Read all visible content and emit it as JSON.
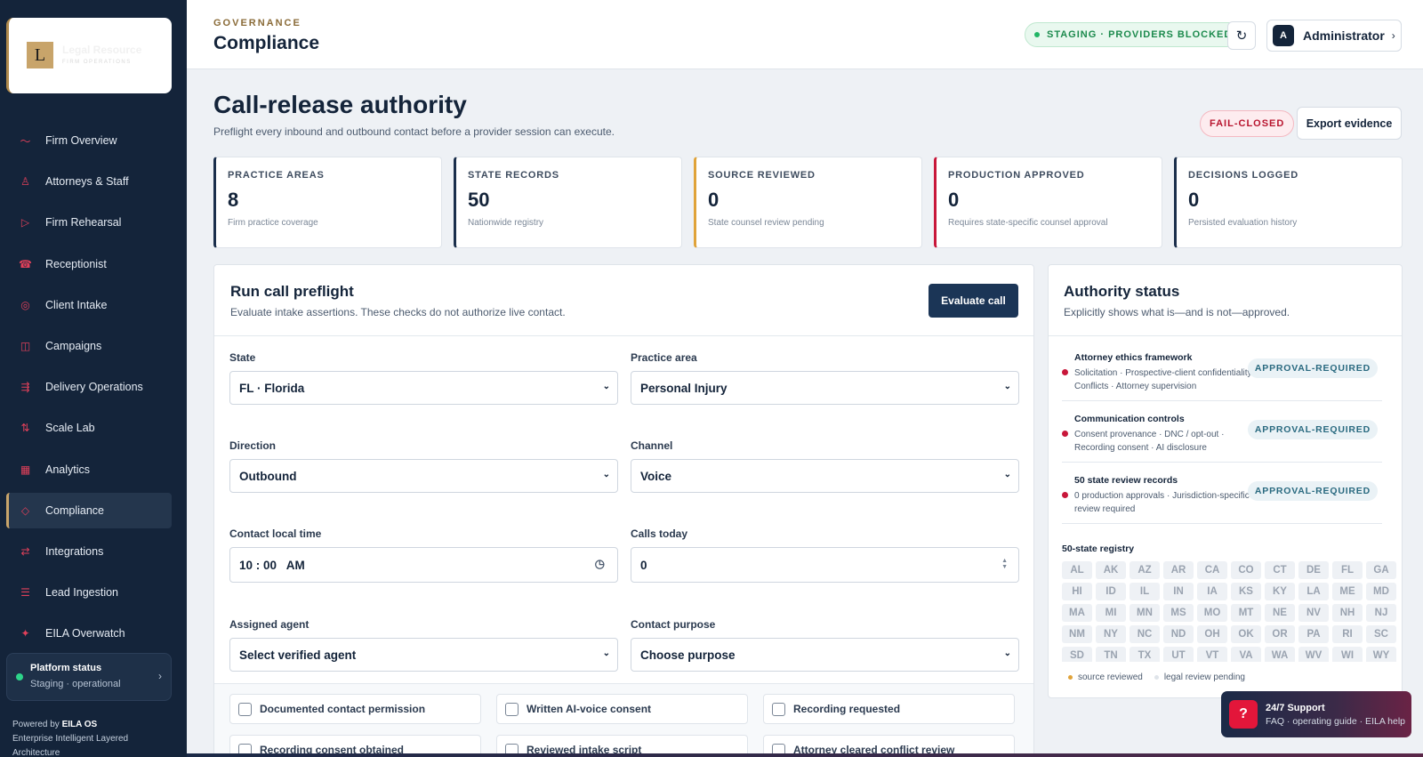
{
  "brand": {
    "logo_letter": "L",
    "name": "Legal Resource",
    "tagline": "FIRM OPERATIONS"
  },
  "sidebar": {
    "items": [
      {
        "label": "Firm Overview",
        "icon": "pulse-icon"
      },
      {
        "label": "Attorneys & Staff",
        "icon": "person-icon"
      },
      {
        "label": "Firm Rehearsal",
        "icon": "play-icon"
      },
      {
        "label": "Receptionist",
        "icon": "phone-icon"
      },
      {
        "label": "Client Intake",
        "icon": "target-icon"
      },
      {
        "label": "Campaigns",
        "icon": "columns-icon"
      },
      {
        "label": "Delivery Operations",
        "icon": "list-arrow-icon"
      },
      {
        "label": "Scale Lab",
        "icon": "sort-icon"
      },
      {
        "label": "Analytics",
        "icon": "grid-icon"
      },
      {
        "label": "Compliance",
        "icon": "diamond-icon",
        "active": true
      },
      {
        "label": "Integrations",
        "icon": "swap-icon"
      },
      {
        "label": "Lead Ingestion",
        "icon": "list-icon"
      },
      {
        "label": "EILA Overwatch",
        "icon": "sparkle-icon"
      }
    ],
    "platform_status": {
      "title": "Platform status",
      "subtitle": "Staging · operational"
    },
    "powered_prefix": "Powered by",
    "powered_brand": "EILA OS",
    "powered_line": "Enterprise Intelligent Layered Architecture"
  },
  "header": {
    "eyebrow": "GOVERNANCE",
    "title": "Compliance",
    "env_status": "STAGING · PROVIDERS BLOCKED",
    "refresh_glyph": "↻",
    "user_initial": "A",
    "user_name": "Administrator",
    "user_chevron": "›"
  },
  "page": {
    "title": "Call-release authority",
    "subtitle": "Preflight every inbound and outbound contact before a provider session can execute.",
    "mode_badge": "FAIL-CLOSED",
    "export_label": "Export evidence"
  },
  "stats": [
    {
      "label": "PRACTICE AREAS",
      "value": "8",
      "sub": "Firm practice coverage",
      "accent": "#1b2f4c"
    },
    {
      "label": "STATE RECORDS",
      "value": "50",
      "sub": "Nationwide registry",
      "accent": "#1b2f4c"
    },
    {
      "label": "SOURCE REVIEWED",
      "value": "0",
      "sub": "State counsel review pending",
      "accent": "#e0a33a"
    },
    {
      "label": "PRODUCTION APPROVED",
      "value": "0",
      "sub": "Requires state-specific counsel approval",
      "accent": "#c8173a"
    },
    {
      "label": "DECISIONS LOGGED",
      "value": "0",
      "sub": "Persisted evaluation history",
      "accent": "#1b2f4c"
    }
  ],
  "preflight": {
    "title": "Run call preflight",
    "subtitle": "Evaluate intake assertions. These checks do not authorize live contact.",
    "evaluate_label": "Evaluate call",
    "fields": {
      "state": {
        "label": "State",
        "value": "FL · Florida"
      },
      "practice_area": {
        "label": "Practice area",
        "value": "Personal Injury"
      },
      "direction": {
        "label": "Direction",
        "value": "Outbound"
      },
      "channel": {
        "label": "Channel",
        "value": "Voice"
      },
      "local_time": {
        "label": "Contact local time",
        "value": "10 : 00   AM"
      },
      "calls_today": {
        "label": "Calls today",
        "value": "0"
      },
      "agent": {
        "label": "Assigned agent",
        "value": "Select verified agent"
      },
      "purpose": {
        "label": "Contact purpose",
        "value": "Choose purpose"
      }
    },
    "checks": [
      "Documented contact permission",
      "Written AI-voice consent",
      "Recording requested",
      "Recording consent obtained",
      "Reviewed intake script",
      "Attorney cleared conflict review"
    ]
  },
  "authority": {
    "title": "Authority status",
    "subtitle": "Explicitly shows what is—and is not—approved.",
    "items": [
      {
        "title": "Attorney ethics framework",
        "desc": "Solicitation · Prospective-client confidentiality · Conflicts · Attorney supervision",
        "badge": "APPROVAL-REQUIRED"
      },
      {
        "title": "Communication controls",
        "desc": "Consent provenance · DNC / opt-out · Recording consent · AI disclosure",
        "badge": "APPROVAL-REQUIRED"
      },
      {
        "title": "50 state review records",
        "desc": "0 production approvals · Jurisdiction-specific review required",
        "badge": "APPROVAL-REQUIRED"
      }
    ],
    "registry_title": "50-state registry",
    "states": [
      "AL",
      "AK",
      "AZ",
      "AR",
      "CA",
      "CO",
      "CT",
      "DE",
      "FL",
      "GA",
      "HI",
      "ID",
      "IL",
      "IN",
      "IA",
      "KS",
      "KY",
      "LA",
      "ME",
      "MD",
      "MA",
      "MI",
      "MN",
      "MS",
      "MO",
      "MT",
      "NE",
      "NV",
      "NH",
      "NJ",
      "NM",
      "NY",
      "NC",
      "ND",
      "OH",
      "OK",
      "OR",
      "PA",
      "RI",
      "SC",
      "SD",
      "TN",
      "TX",
      "UT",
      "VT",
      "VA",
      "WA",
      "WV",
      "WI",
      "WY"
    ],
    "legend": [
      {
        "label": "source reviewed",
        "color": "#e0a33a"
      },
      {
        "label": "legal review pending",
        "color": "#dfe4ea"
      }
    ]
  },
  "support": {
    "badge": "?",
    "title": "24/7 Support",
    "subtitle": "FAQ · operating guide · EILA help"
  },
  "colors": {
    "sidebar": "#14243a",
    "accent_gold": "#c8a46a",
    "danger": "#c8173a",
    "success": "#22b566"
  }
}
